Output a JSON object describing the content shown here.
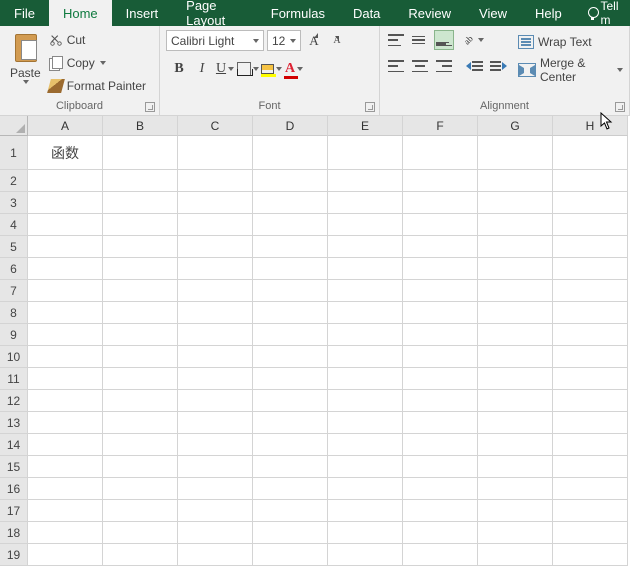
{
  "tabs": {
    "file": "File",
    "home": "Home",
    "insert": "Insert",
    "pagelayout": "Page Layout",
    "formulas": "Formulas",
    "data": "Data",
    "review": "Review",
    "view": "View",
    "help": "Help",
    "tell": "Tell m"
  },
  "clipboard": {
    "paste": "Paste",
    "cut": "Cut",
    "copy": "Copy",
    "formatpainter": "Format Painter",
    "label": "Clipboard"
  },
  "font": {
    "name": "Calibri Light",
    "size": "12",
    "label": "Font",
    "b": "B",
    "i": "I",
    "u": "U",
    "A": "A"
  },
  "alignment": {
    "wrap": "Wrap Text",
    "merge": "Merge & Center",
    "label": "Alignment"
  },
  "columns": [
    "A",
    "B",
    "C",
    "D",
    "E",
    "F",
    "G",
    "H"
  ],
  "rows": [
    "1",
    "2",
    "3",
    "4",
    "5",
    "6",
    "7",
    "8",
    "9",
    "10",
    "11",
    "12",
    "13",
    "14",
    "15",
    "16",
    "17",
    "18",
    "19"
  ],
  "cells": {
    "A1": "函数"
  }
}
